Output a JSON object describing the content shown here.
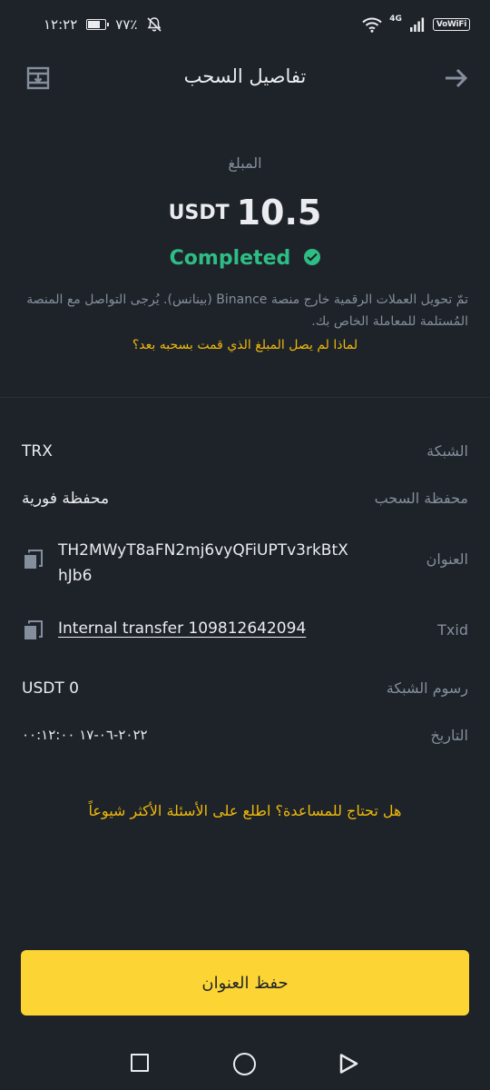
{
  "status_bar": {
    "time": "١٢:٢٢",
    "battery": "٧٧٪",
    "battery_level": 0.77,
    "network": "4G",
    "vowifi": "VoWiFi",
    "icons": [
      "battery-icon",
      "mute-bell-icon",
      "wifi-icon",
      "signal-icon"
    ]
  },
  "header": {
    "title": "تفاصيل السحب",
    "left_icon": "export-record-icon",
    "right_icon": "arrow-right-icon"
  },
  "amount": {
    "label": "المبلغ",
    "currency": "USDT",
    "value": "10.5"
  },
  "status": {
    "text": "Completed",
    "color": "#2ebd85",
    "icon": "check-circle-icon"
  },
  "notice": "تمّ تحويل العملات الرقمية خارج منصة Binance (بينانس). يُرجى التواصل مع المنصة المُستلمة للمعاملة الخاص بك.",
  "why_link": "لماذا لم يصل المبلغ الذي قمت بسحبه بعد؟",
  "details": {
    "network": {
      "label": "الشبكة",
      "value": "TRX"
    },
    "wallet": {
      "label": "محفظة السحب",
      "value": "محفظة فورية"
    },
    "address": {
      "label": "العنوان",
      "value": "TH2MWyT8aFN2mj6vyQFiUPTv3rkBtXhJb6",
      "icon": "copy-icon"
    },
    "txid": {
      "label": "Txid",
      "value": "Internal transfer 109812642094",
      "icon": "copy-icon"
    },
    "fee": {
      "label": "رسوم الشبكة",
      "value": "USDT 0"
    },
    "date": {
      "label": "التاريخ",
      "value": "٢٠٢٢-٠٦-١٧ ٠٠:١٢:٠٠"
    }
  },
  "help_link": "هل تحتاج للمساعدة؟ اطلع على الأسئلة الأكثر شيوعاً",
  "save_button": "حفظ العنوان",
  "colors": {
    "background": "#1e2329",
    "accent": "#fcd535",
    "link": "#f0b90b",
    "muted": "#848e9c"
  },
  "nav_bar": {
    "icons": [
      "recents-square-icon",
      "home-circle-icon",
      "back-triangle-icon"
    ]
  }
}
